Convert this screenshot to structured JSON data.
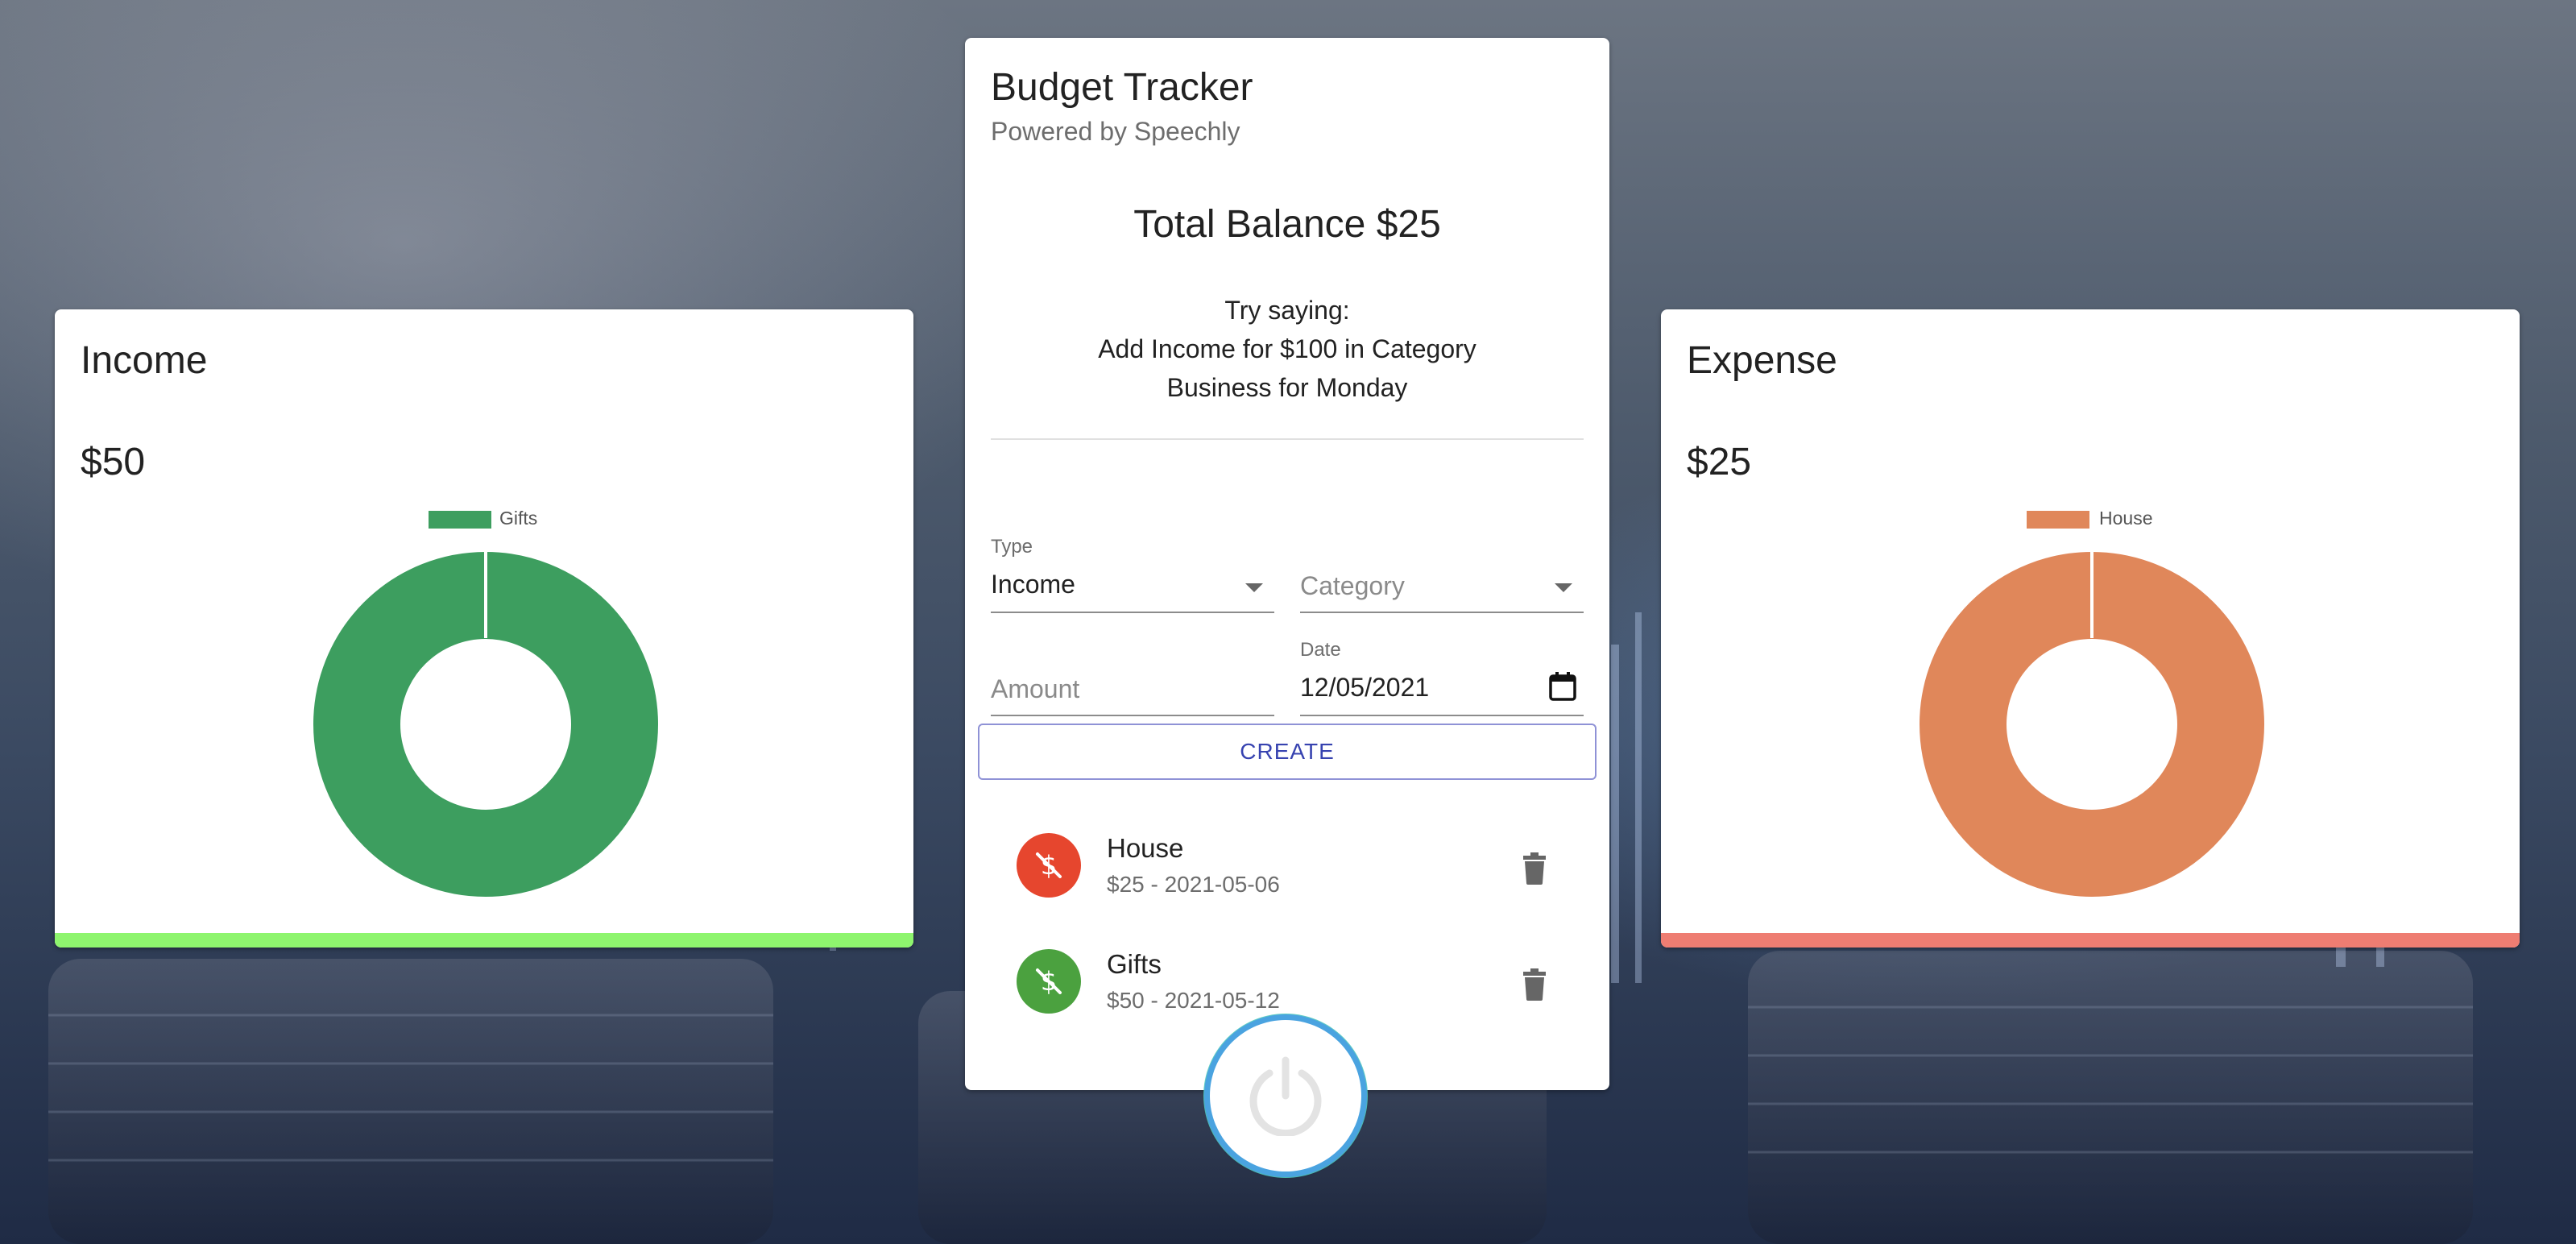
{
  "income": {
    "title": "Income",
    "amount": "$50",
    "legend_label": "Gifts",
    "color": "#3d9e5f",
    "bar_color": "#8ef56e"
  },
  "expense": {
    "title": "Expense",
    "amount": "$25",
    "legend_label": "House",
    "color": "#e0875a",
    "bar_color": "#ee7d72"
  },
  "main": {
    "title": "Budget Tracker",
    "subtitle": "Powered by Speechly",
    "balance": "Total Balance $25",
    "hint_line1": "Try saying:",
    "hint_line2": "Add Income for $100 in Category",
    "hint_line3": "Business for Monday"
  },
  "form": {
    "type_label": "Type",
    "type_value": "Income",
    "category_placeholder": "Category",
    "amount_placeholder": "Amount",
    "date_label": "Date",
    "date_value": "12/05/2021",
    "create_label": "CREATE"
  },
  "transactions": [
    {
      "title": "House",
      "sub": "$25 - 2021-05-06",
      "color": "#e6462e",
      "icon": "money-off-icon"
    },
    {
      "title": "Gifts",
      "sub": "$50 - 2021-05-12",
      "color": "#4ba13f",
      "icon": "money-off-icon"
    }
  ],
  "icons": {
    "delete": "trash-icon",
    "calendar": "calendar-icon",
    "power": "power-icon"
  }
}
